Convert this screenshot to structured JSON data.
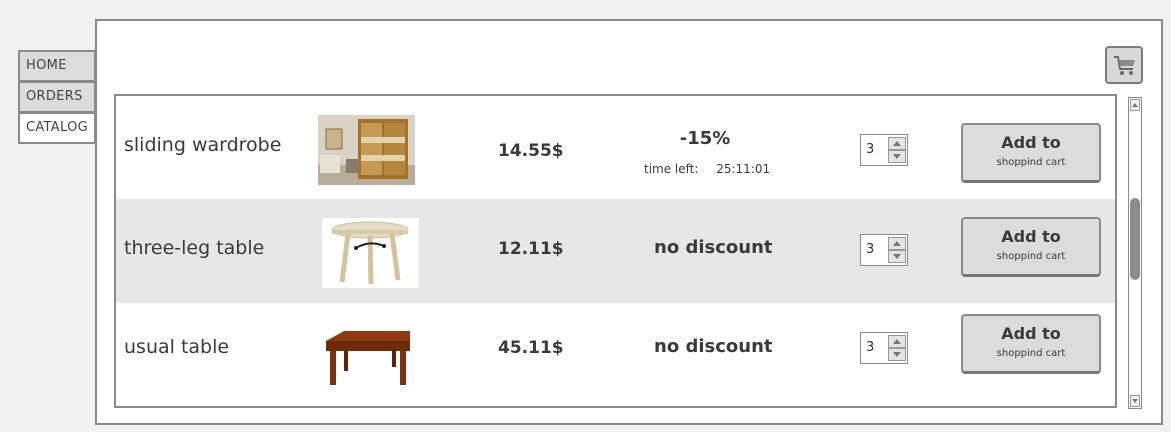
{
  "nav": {
    "items": [
      {
        "label": "HOME"
      },
      {
        "label": "ORDERS"
      },
      {
        "label": "CATALOG",
        "active": true
      }
    ]
  },
  "header": {
    "cart_icon": "shopping-cart-icon"
  },
  "products": [
    {
      "name": "sliding wardrobe",
      "price": "14.55$",
      "discount": "-15%",
      "time_left_label": "time left:",
      "time_left": "25:11:01",
      "quantity": "3",
      "add_label_1": "Add to",
      "add_label_2": "shoppind cart",
      "image": "wardrobe-photo"
    },
    {
      "name": "three-leg table",
      "price": "12.11$",
      "discount": "no discount",
      "quantity": "3",
      "add_label_1": "Add to",
      "add_label_2": "shoppind cart",
      "image": "round-table-photo"
    },
    {
      "name": "usual table",
      "price": "45.11$",
      "discount": "no discount",
      "quantity": "3",
      "add_label_1": "Add to",
      "add_label_2": "shoppind cart",
      "image": "wooden-table-photo"
    }
  ]
}
